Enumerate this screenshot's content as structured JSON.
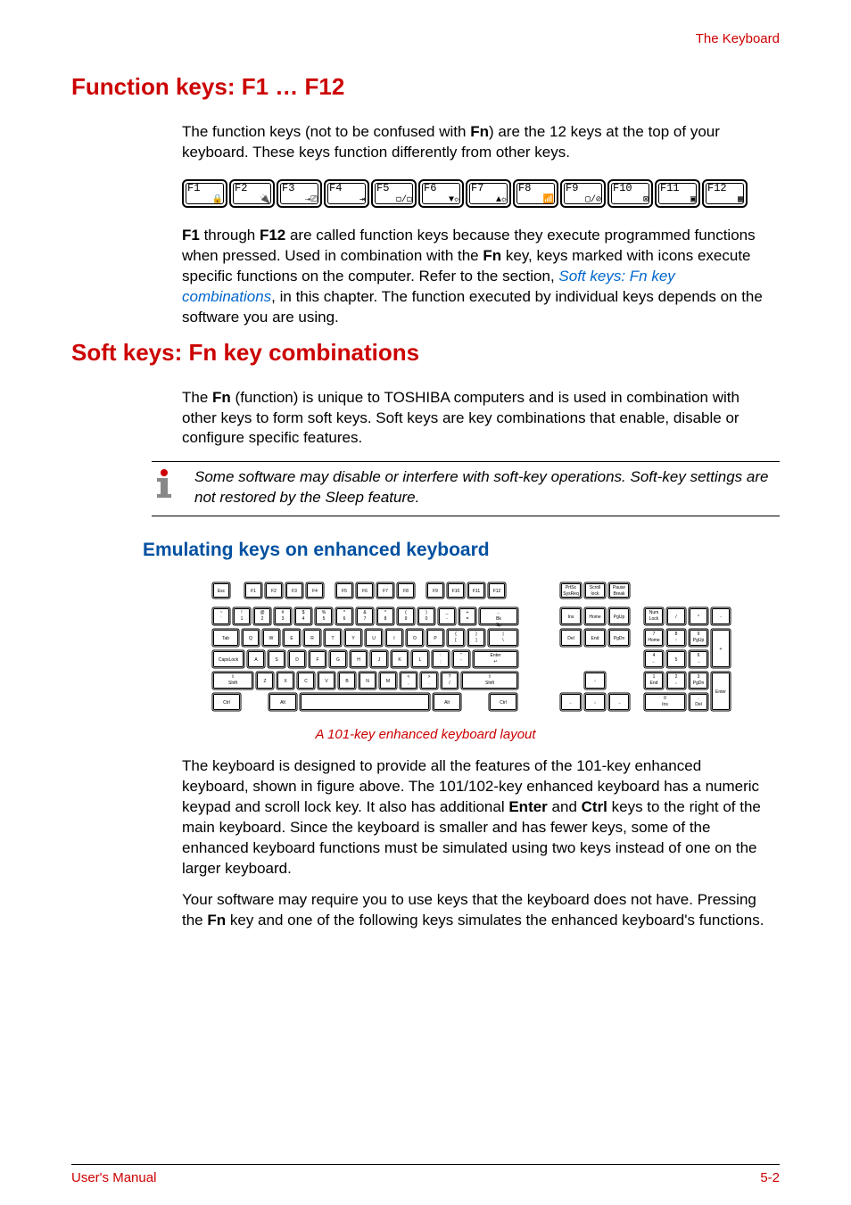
{
  "header": {
    "section": "The Keyboard"
  },
  "h1a": "Function keys: F1 … F12",
  "para1_pre": "The function keys (not to be confused with ",
  "para1_bold": "Fn",
  "para1_post": ") are the 12 keys at the top of your keyboard. These keys function differently from other keys.",
  "fkeys": [
    {
      "label": "F1",
      "glyph": "🔒"
    },
    {
      "label": "F2",
      "glyph": "🔌"
    },
    {
      "label": "F3",
      "glyph": "⇢⎚"
    },
    {
      "label": "F4",
      "glyph": "⇥"
    },
    {
      "label": "F5",
      "glyph": "◻/◻"
    },
    {
      "label": "F6",
      "glyph": "▼☼"
    },
    {
      "label": "F7",
      "glyph": "▲☼"
    },
    {
      "label": "F8",
      "glyph": "📶"
    },
    {
      "label": "F9",
      "glyph": "▢/⊘"
    },
    {
      "label": "F10",
      "glyph": "⊠"
    },
    {
      "label": "F11",
      "glyph": "▣"
    },
    {
      "label": "F12",
      "glyph": "▦"
    }
  ],
  "para2_a": "F1",
  "para2_b": " through ",
  "para2_c": "F12",
  "para2_d": " are called function keys because they execute programmed functions when pressed. Used in combination with the ",
  "para2_e": "Fn",
  "para2_f": " key, keys marked with icons execute specific functions on the computer. Refer to the section, ",
  "para2_link": "Soft keys: Fn key combinations",
  "para2_g": ", in this chapter. The function executed by individual keys depends on the software you are using.",
  "h1b": "Soft keys: Fn key combinations",
  "para3_a": "The ",
  "para3_b": "Fn",
  "para3_c": " (function) is unique to TOSHIBA computers and is used in combination with other keys to form soft keys. Soft keys are key combinations that enable, disable or configure specific features.",
  "note": "Some software may disable or interfere with soft-key operations. Soft-key settings are not restored by the Sleep feature.",
  "h3": "Emulating keys on enhanced keyboard",
  "caption": "A 101-key enhanced keyboard layout",
  "para4_a": "The keyboard is designed to provide all the features of the 101-key enhanced keyboard, shown in figure above. The 101/102-key enhanced keyboard has a numeric keypad and scroll lock key. It also has additional ",
  "para4_b": "Enter",
  "para4_c": " and ",
  "para4_d": "Ctrl",
  "para4_e": " keys to the right of the main keyboard. Since the keyboard is smaller and has fewer keys, some of the enhanced keyboard functions must be simulated using two keys instead of one on the larger keyboard.",
  "para5_a": "Your software may require you to use keys that the keyboard does not have. Pressing the ",
  "para5_b": "Fn",
  "para5_c": " key and one of the following keys simulates the enhanced keyboard's functions.",
  "footer": {
    "left": "User's Manual",
    "right": "5-2"
  },
  "kb": {
    "row0": [
      "Esc",
      "F1",
      "F2",
      "F3",
      "F4",
      "F5",
      "F6",
      "F7",
      "F8",
      "F9",
      "F10",
      "F11",
      "F12"
    ],
    "row0_right": [
      "PrtSc SysReq",
      "Scroll lock",
      "Pause Break"
    ],
    "row1": [
      "~ `",
      "! 1",
      "@ 2",
      "# 3",
      "$ 4",
      "% 5",
      "^ 6",
      "& 7",
      "* 8",
      "( 9",
      ") 0",
      "_ -",
      "+ =",
      "← Bk Sp"
    ],
    "row1_right": [
      "Ins",
      "Home",
      "PgUp"
    ],
    "row1_num": [
      "Num Lock",
      "/",
      "*",
      "-"
    ],
    "row2": [
      "Tab",
      "Q",
      "W",
      "E",
      "R",
      "T",
      "Y",
      "U",
      "I",
      "O",
      "P",
      "{ [",
      "} ]",
      "| \\"
    ],
    "row2_right": [
      "Del",
      "End",
      "PgDn"
    ],
    "row2_num": [
      "7 Home",
      "8 ↑",
      "9 PgUp"
    ],
    "row3": [
      "CapsLock",
      "A",
      "S",
      "D",
      "F",
      "G",
      "H",
      "J",
      "K",
      "L",
      ": ;",
      "\" '",
      "Enter ↵"
    ],
    "row3_num": [
      "4 ←",
      "5",
      "6 →",
      "+"
    ],
    "row4": [
      "⇧ Shift",
      "Z",
      "X",
      "C",
      "V",
      "B",
      "N",
      "M",
      "< ,",
      "> .",
      "? /",
      "⇧ Shift"
    ],
    "row4_mid": [
      "↑"
    ],
    "row4_num": [
      "1 End",
      "2 ↓",
      "3 PgDn"
    ],
    "row5": [
      "Ctrl",
      "Alt",
      "",
      "Alt",
      "Ctrl"
    ],
    "row5_mid": [
      "←",
      "↓",
      "→"
    ],
    "row5_num": [
      "0 Ins",
      ". Del",
      "Enter"
    ]
  }
}
